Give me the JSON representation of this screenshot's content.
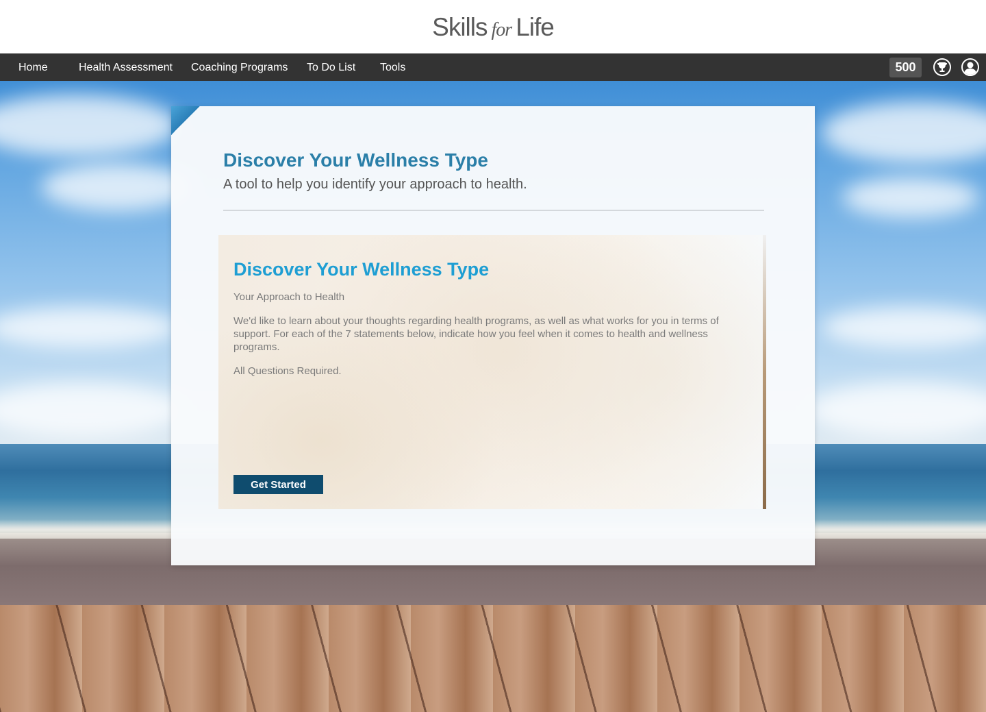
{
  "brand": {
    "logo_part1": "Skills",
    "logo_part2": "for",
    "logo_part3": "Life"
  },
  "nav": {
    "items": [
      {
        "label": "Home"
      },
      {
        "label": "Health Assessment"
      },
      {
        "label": "Coaching Programs"
      },
      {
        "label": "To Do List"
      },
      {
        "label": "Tools"
      }
    ],
    "points": "500",
    "icons": [
      "trophy-icon",
      "user-profile-icon"
    ]
  },
  "card": {
    "title": "Discover Your Wellness Type",
    "subtitle": "A tool to help you identify your approach to health."
  },
  "panel": {
    "title": "Discover Your Wellness Type",
    "heading": "Your Approach to Health",
    "description": "We'd like to learn about your thoughts regarding health programs, as well as what works for you in terms of support. For each of the 7 statements below, indicate how you feel when it comes to health and wellness programs.",
    "note": "All Questions Required.",
    "button_label": "Get Started"
  },
  "colors": {
    "nav_bg": "#333333",
    "title_blue": "#2b7fa8",
    "panel_title_blue": "#1e9ed3",
    "button_bg": "#0f4c6e"
  }
}
